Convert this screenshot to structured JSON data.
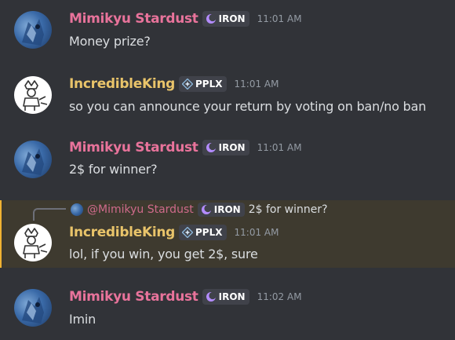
{
  "messages": [
    {
      "username": "Mimikyu Stardust",
      "tag": "IRON",
      "time": "11:01 AM",
      "text": "Money prize?"
    },
    {
      "username": "IncredibleKing",
      "tag": "PPLX",
      "time": "11:01 AM",
      "text": "so you can announce your return by voting on ban/no ban"
    },
    {
      "username": "Mimikyu Stardust",
      "tag": "IRON",
      "time": "11:01 AM",
      "text": "2$ for winner?"
    },
    {
      "username": "IncredibleKing",
      "tag": "PPLX",
      "time": "11:01 AM",
      "text": "lol, if you win, you get 2$, sure",
      "reply": {
        "username": "@Mimikyu Stardust",
        "tag": "IRON",
        "text": "2$ for winner?"
      }
    },
    {
      "username": "Mimikyu Stardust",
      "tag": "IRON",
      "time": "11:02 AM",
      "text": "Imin"
    }
  ],
  "colors": {
    "background": "#313338",
    "mimikyu_name": "#e8739b",
    "king_name": "#e9c46a",
    "iron_tag_icon": "#b48cff",
    "pplx_tag_icon": "#8ab4d8",
    "highlight_bg": "#3e3a2f",
    "highlight_bar": "#f0b232"
  },
  "icons": {
    "iron": "crescent-moon-icon",
    "pplx": "diamond-star-icon"
  }
}
